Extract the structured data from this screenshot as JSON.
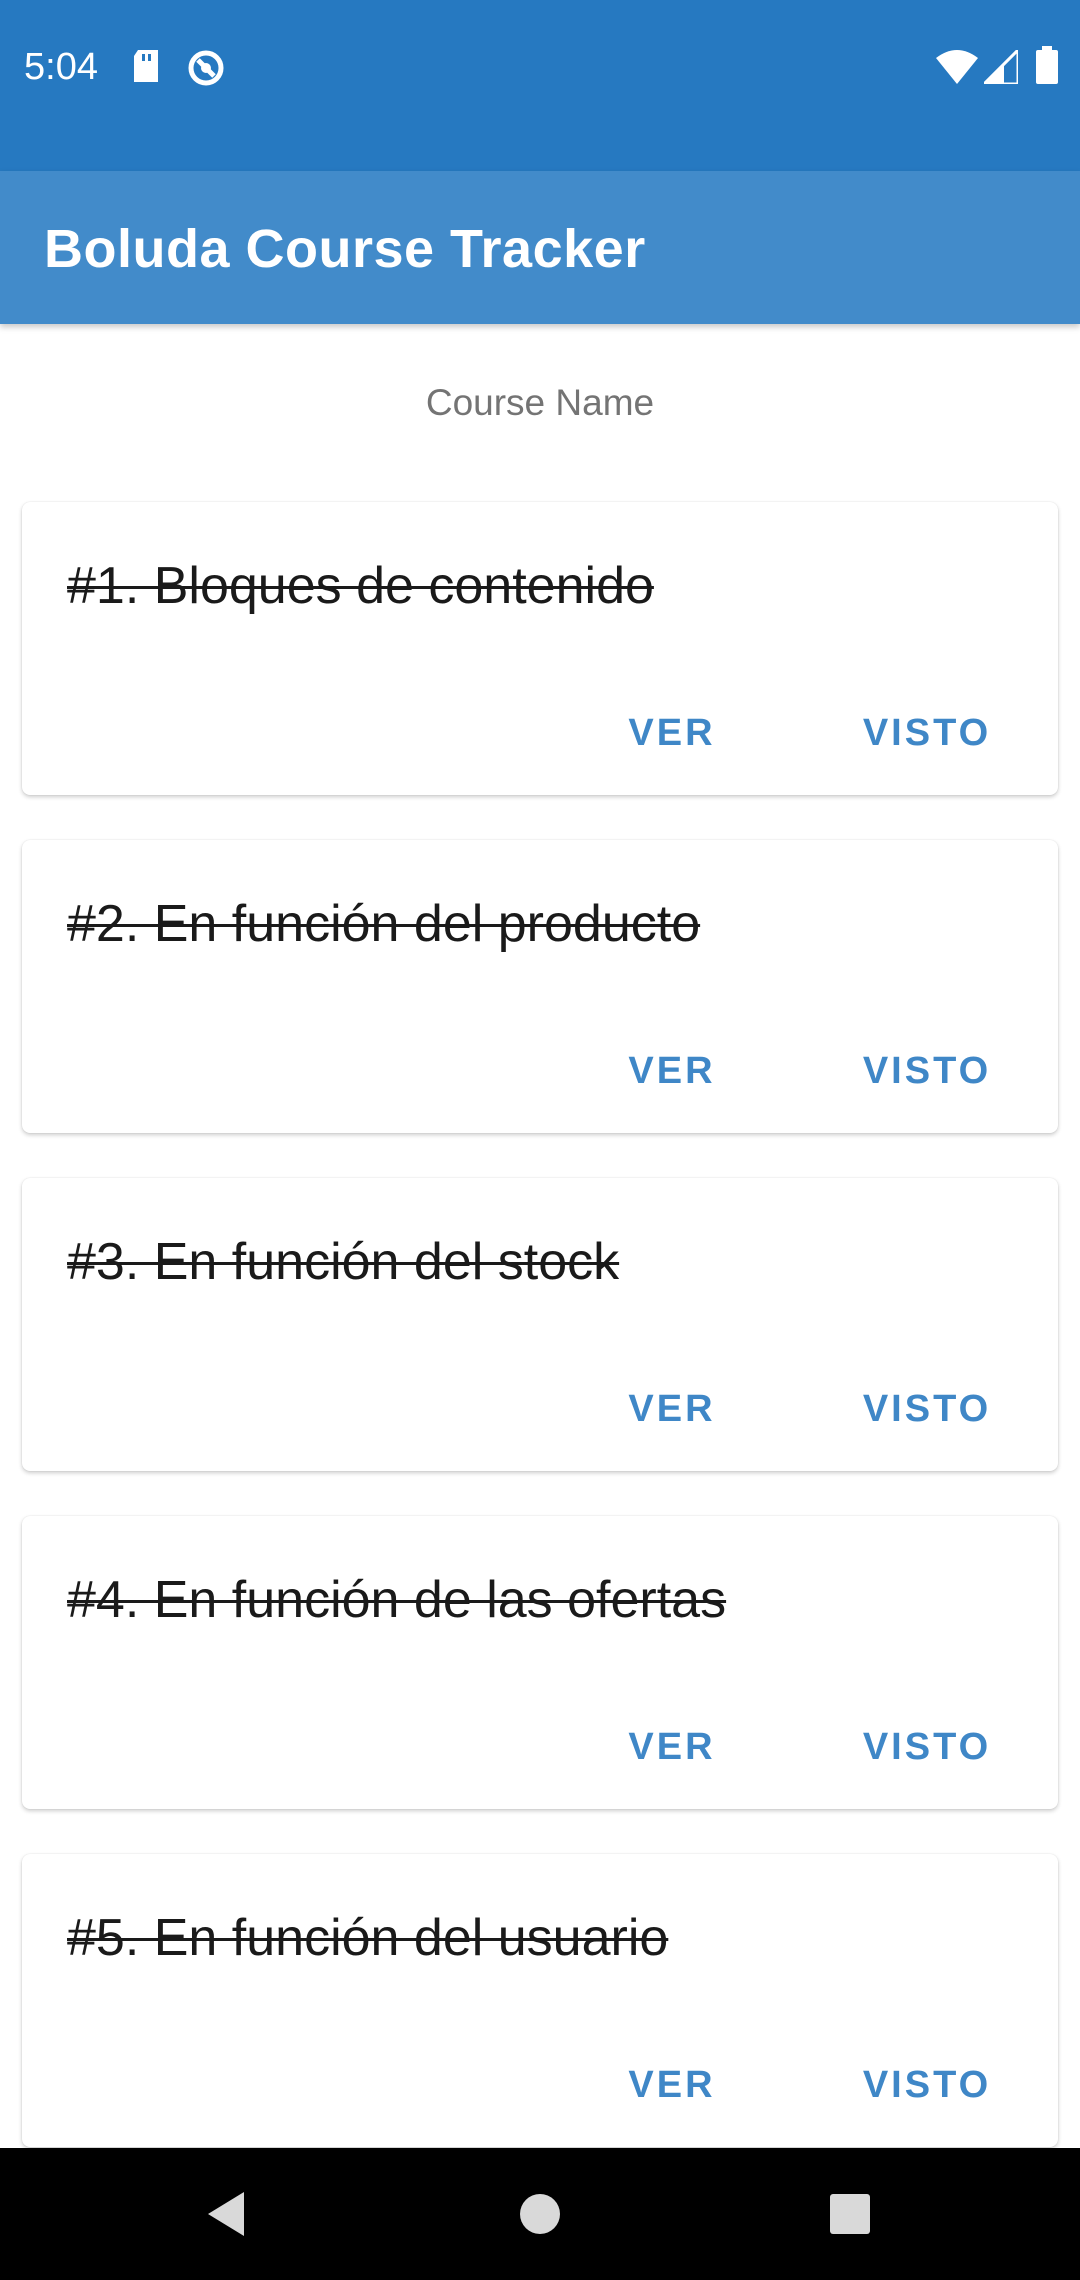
{
  "status_bar": {
    "time": "5:04",
    "left_icons": [
      "sd-card-icon",
      "data-saver-icon"
    ],
    "right_icons": [
      "wifi-icon",
      "cellular-signal-icon",
      "battery-icon"
    ]
  },
  "app_bar": {
    "title": "Boluda Course Tracker"
  },
  "main": {
    "course_name": "Course Name",
    "lessons": [
      {
        "title": "#1. Bloques de contenido",
        "view_label": "VER",
        "seen_label": "VISTO"
      },
      {
        "title": "#2. En función del producto",
        "view_label": "VER",
        "seen_label": "VISTO"
      },
      {
        "title": "#3. En función del stock",
        "view_label": "VER",
        "seen_label": "VISTO"
      },
      {
        "title": "#4. En función de las ofertas",
        "view_label": "VER",
        "seen_label": "VISTO"
      },
      {
        "title": "#5. En función del usuario",
        "view_label": "VER",
        "seen_label": "VISTO"
      }
    ]
  },
  "nav_bar": {
    "buttons": [
      "back-icon",
      "home-icon",
      "recents-icon"
    ]
  },
  "colors": {
    "status_bar": "#2679c1",
    "app_bar": "#428bca",
    "accent": "#3f87c7"
  }
}
